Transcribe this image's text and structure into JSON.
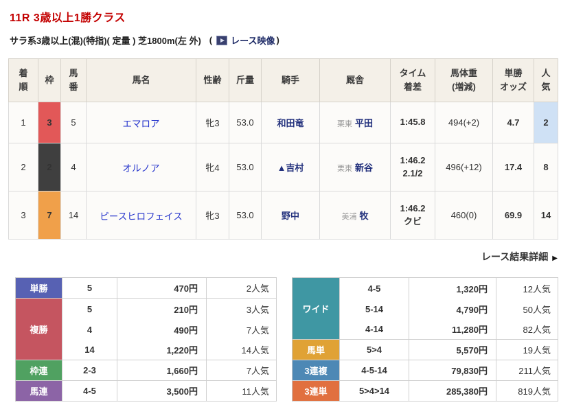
{
  "header": {
    "title": "11R 3歳以上1勝クラス",
    "conditions": "サラ系3歳以上(混)(特指)( 定量 ) 芝1800m(左 外)",
    "video": {
      "open": "(",
      "label": "レース映像",
      "close": ")"
    }
  },
  "results": {
    "columns": [
      "着\n順",
      "枠",
      "馬\n番",
      "馬名",
      "性齢",
      "斤量",
      "騎手",
      "厩舎",
      "タイム\n着差",
      "馬体重\n(増減)",
      "単勝\nオッズ",
      "人\n気"
    ],
    "rows": [
      {
        "pos": "1",
        "waku": "3",
        "waku_color": "#e25858",
        "num": "5",
        "name": "エマロア",
        "sex_age": "牝3",
        "weight": "53.0",
        "jockey": "和田竜",
        "region": "栗東",
        "stable": "平田",
        "time": "1:45.8",
        "margin": "",
        "body_weight": "494(+2)",
        "odds": "4.7",
        "fav": "2",
        "fav_bg": "#cfe1f5"
      },
      {
        "pos": "2",
        "waku": "2",
        "waku_color": "#3f3f3f",
        "num": "4",
        "name": "オルノア",
        "sex_age": "牝4",
        "weight": "53.0",
        "jockey": "▲吉村",
        "region": "栗東",
        "stable": "新谷",
        "time": "1:46.2",
        "margin": "2.1/2",
        "body_weight": "496(+12)",
        "odds": "17.4",
        "fav": "8"
      },
      {
        "pos": "3",
        "waku": "7",
        "waku_color": "#f0a04a",
        "num": "14",
        "name": "ピースヒロフェイス",
        "sex_age": "牝3",
        "weight": "53.0",
        "jockey": "野中",
        "region": "美浦",
        "stable": "牧",
        "time": "1:46.2",
        "margin": "クビ",
        "body_weight": "460(0)",
        "odds": "69.9",
        "fav": "14"
      }
    ]
  },
  "details_link": {
    "label": "レース結果詳細",
    "arrow": "▶"
  },
  "payouts": {
    "left": [
      {
        "label": "単勝",
        "color": "#5761b3",
        "rows": [
          {
            "combo": "5",
            "amount": "470円",
            "fav": "2人気"
          }
        ]
      },
      {
        "label": "複勝",
        "color": "#c55560",
        "rows": [
          {
            "combo": "5",
            "amount": "210円",
            "fav": "3人気"
          },
          {
            "combo": "4",
            "amount": "490円",
            "fav": "7人気"
          },
          {
            "combo": "14",
            "amount": "1,220円",
            "fav": "14人気"
          }
        ]
      },
      {
        "label": "枠連",
        "color": "#50a161",
        "rows": [
          {
            "combo": "2-3",
            "amount": "1,660円",
            "fav": "7人気"
          }
        ]
      },
      {
        "label": "馬連",
        "color": "#8c64a6",
        "rows": [
          {
            "combo": "4-5",
            "amount": "3,500円",
            "fav": "11人気"
          }
        ]
      }
    ],
    "right": [
      {
        "label": "ワイド",
        "color": "#3f97a3",
        "rows": [
          {
            "combo": "4-5",
            "amount": "1,320円",
            "fav": "12人気"
          },
          {
            "combo": "5-14",
            "amount": "4,790円",
            "fav": "50人気"
          },
          {
            "combo": "4-14",
            "amount": "11,280円",
            "fav": "82人気"
          }
        ]
      },
      {
        "label": "馬単",
        "color": "#e0a235",
        "rows": [
          {
            "combo": "5>4",
            "amount": "5,570円",
            "fav": "19人気"
          }
        ]
      },
      {
        "label": "3連複",
        "color": "#4d88b5",
        "rows": [
          {
            "combo": "4-5-14",
            "amount": "79,830円",
            "fav": "211人気"
          }
        ]
      },
      {
        "label": "3連単",
        "color": "#e1703f",
        "rows": [
          {
            "combo": "5>4>14",
            "amount": "285,380円",
            "fav": "819人気"
          }
        ]
      }
    ]
  }
}
